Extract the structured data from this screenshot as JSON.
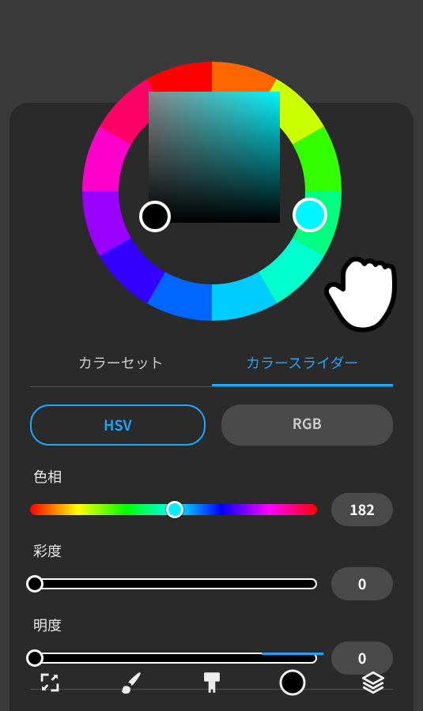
{
  "tabs": {
    "set": "カラーセット",
    "slider": "カラースライダー"
  },
  "modes": {
    "hsv": "HSV",
    "rgb": "RGB"
  },
  "sliders": {
    "hue": {
      "label": "色相",
      "value": "182",
      "percent": 50.5
    },
    "sat": {
      "label": "彩度",
      "value": "0",
      "percent": 1
    },
    "val": {
      "label": "明度",
      "value": "0",
      "percent": 1
    }
  },
  "current_color": "#000000",
  "wheel_hue_color": "#00f6ff",
  "icons": {
    "transform": "transform-icon",
    "brush": "brush-icon",
    "paint": "paint-icon",
    "color": "color-circle-icon",
    "layers": "layers-icon"
  }
}
